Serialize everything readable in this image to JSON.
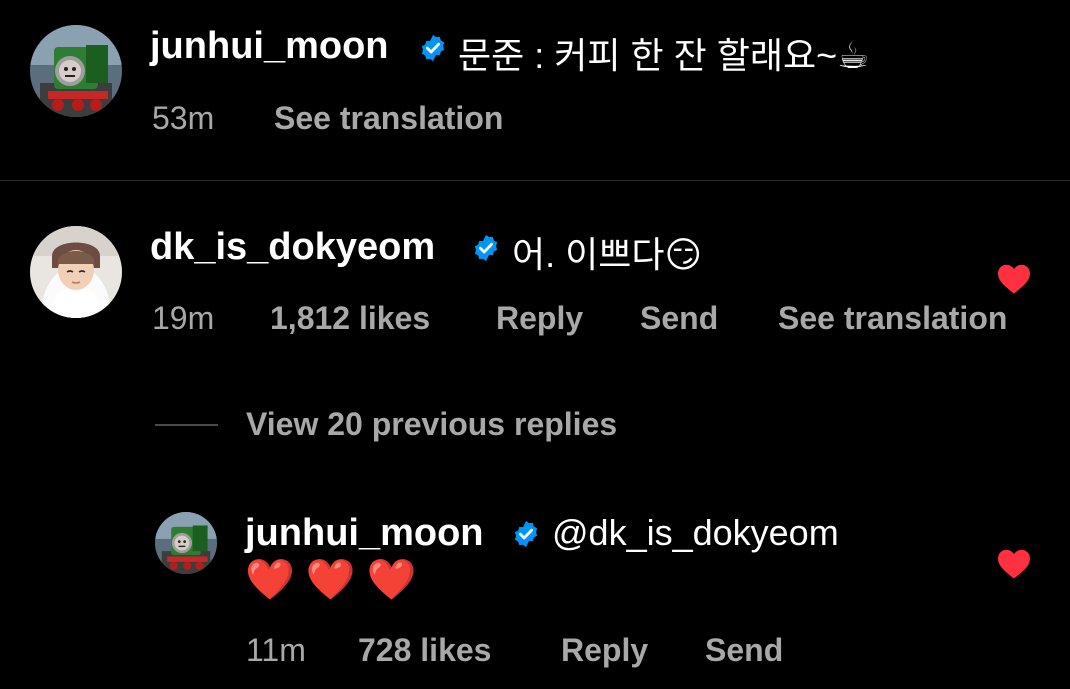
{
  "comments": [
    {
      "username": "junhui_moon",
      "verified": true,
      "text": "문준 : 커피 한 잔 할래요~☕",
      "time": "53m",
      "see_translation": "See translation",
      "avatar": "train-avatar"
    },
    {
      "username": "dk_is_dokyeom",
      "verified": true,
      "text": "어. 이쁘다😏",
      "time": "19m",
      "likes": "1,812 likes",
      "reply": "Reply",
      "send": "Send",
      "see_translation": "See translation",
      "liked": true,
      "avatar": "person-avatar"
    }
  ],
  "view_replies": "View 20 previous replies",
  "reply": {
    "username": "junhui_moon",
    "verified": true,
    "mention": "@dk_is_dokyeom",
    "text": "❤️ ❤️ ❤️",
    "time": "11m",
    "likes": "728 likes",
    "reply": "Reply",
    "send": "Send",
    "liked": true,
    "avatar": "train-avatar"
  },
  "colors": {
    "background": "#000000",
    "meta_text": "#a8a8a8",
    "verified_blue": "#0095f6",
    "like_red": "#ff3040"
  }
}
